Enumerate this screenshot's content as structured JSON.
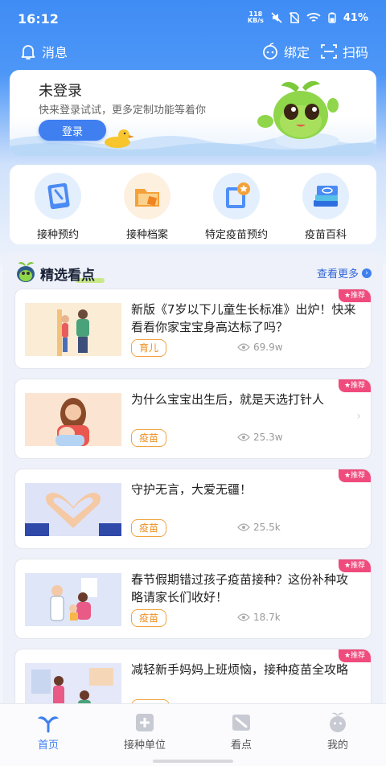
{
  "status_bar": {
    "time": "16:12",
    "network_speed_value": "118",
    "network_speed_unit": "KB/s",
    "battery": "41%"
  },
  "header": {
    "message_label": "消息",
    "bind_label": "绑定",
    "scan_label": "扫码"
  },
  "login_card": {
    "title": "未登录",
    "subtitle": "快来登录试试，更多定制功能等着你",
    "button_label": "登录"
  },
  "menu": [
    {
      "label": "接种预约",
      "icon": "clipboard-vaccine-icon"
    },
    {
      "label": "接种档案",
      "icon": "folder-archive-icon"
    },
    {
      "label": "特定疫苗预约",
      "icon": "special-vaccine-book-icon"
    },
    {
      "label": "疫苗百科",
      "icon": "encyclopedia-books-icon"
    }
  ],
  "section": {
    "title": "精选看点",
    "more_label": "查看更多"
  },
  "articles": [
    {
      "title": "新版《7岁以下儿童生长标准》出炉！快来看看你家宝宝身高达标了吗？",
      "tag": "育儿",
      "views": "69.9w",
      "badge": "推荐"
    },
    {
      "title": "为什么宝宝出生后，就是天选打针人",
      "tag": "疫苗",
      "views": "25.3w",
      "badge": "推荐"
    },
    {
      "title": "守护无言，大爱无疆！",
      "tag": "疫苗",
      "views": "25.5k",
      "badge": "推荐"
    },
    {
      "title": "春节假期错过孩子疫苗接种？这份补种攻略请家长们收好！",
      "tag": "疫苗",
      "views": "18.7k",
      "badge": "推荐"
    },
    {
      "title": "减轻新手妈妈上班烦恼，接种疫苗全攻略",
      "tag": "",
      "views": "",
      "badge": "推荐"
    }
  ],
  "bottom_nav": [
    {
      "label": "首页",
      "active": true
    },
    {
      "label": "接种单位",
      "active": false
    },
    {
      "label": "看点",
      "active": false
    },
    {
      "label": "我的",
      "active": false
    }
  ],
  "colors": {
    "brand_blue": "#3f7ff0",
    "tag_orange": "#ef8f20",
    "badge_pink": "#ef4b7d"
  }
}
